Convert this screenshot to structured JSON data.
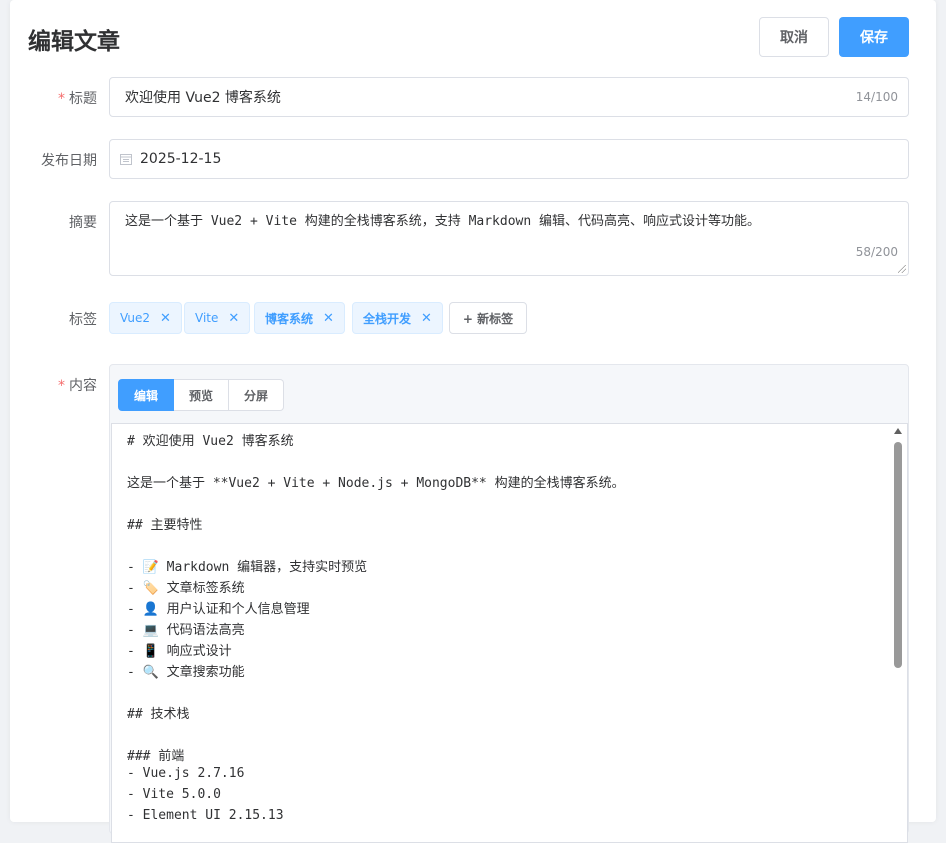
{
  "header": {
    "title": "编辑文章",
    "cancel_label": "取消",
    "save_label": "保存"
  },
  "form": {
    "title_label": "标题",
    "title_value": "欢迎使用 Vue2 博客系统",
    "title_count": "14/100",
    "date_label": "发布日期",
    "date_value": "2025-12-15",
    "summary_label": "摘要",
    "summary_value": "这是一个基于 Vue2 + Vite 构建的全栈博客系统，支持 Markdown 编辑、代码高亮、响应式设计等功能。",
    "summary_count": "58/200",
    "tags_label": "标签",
    "tags": [
      "Vue2",
      "Vite",
      "博客系统",
      "全栈开发"
    ],
    "new_tag_label": "+ 新标签",
    "content_label": "内容"
  },
  "editor": {
    "tabs": [
      "编辑",
      "预览",
      "分屏"
    ],
    "active_tab": "编辑",
    "lines": [
      "# 欢迎使用 Vue2 博客系统",
      "",
      "这是一个基于 **Vue2 + Vite + Node.js + MongoDB** 构建的全栈博客系统。",
      "",
      "## 主要特性",
      "",
      "- 📝 Markdown 编辑器，支持实时预览",
      "- 🏷️ 文章标签系统",
      "- 👤 用户认证和个人信息管理",
      "- 💻 代码语法高亮",
      "- 📱 响应式设计",
      "- 🔍 文章搜索功能",
      "",
      "## 技术栈",
      "",
      "### 前端",
      "- Vue.js 2.7.16",
      "- Vite 5.0.0",
      "- Element UI 2.15.13"
    ]
  },
  "colors": {
    "primary": "#409eff",
    "required": "#f56c6c"
  },
  "icons": {
    "date": "calendar-icon",
    "tag_close": "close-icon"
  }
}
